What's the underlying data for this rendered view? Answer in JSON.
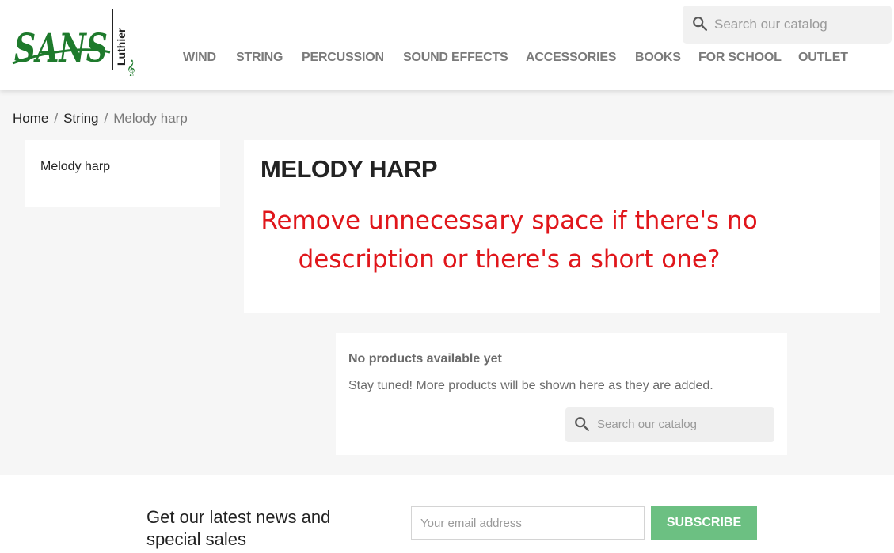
{
  "header": {
    "logo": {
      "text": "SANS",
      "subtext": "Luthier"
    },
    "search_placeholder": "Search our catalog",
    "nav": [
      "WIND",
      "STRING",
      "PERCUSSION",
      "SOUND EFFECTS",
      "ACCESSORIES",
      "BOOKS",
      "FOR SCHOOL",
      "OUTLET"
    ]
  },
  "breadcrumb": {
    "items": [
      "Home",
      "String"
    ],
    "current": "Melody harp"
  },
  "sidebar": {
    "items": [
      "Melody harp"
    ]
  },
  "category": {
    "title": "MELODY HARP",
    "annotation": "Remove unnecessary space if there's no description or there's a short one?"
  },
  "no_products": {
    "title": "No products available yet",
    "message": "Stay tuned! More products will be shown here as they are added.",
    "search_placeholder": "Search our catalog"
  },
  "newsletter": {
    "title": "Get our latest news and special sales",
    "email_placeholder": "Your email address",
    "button": "SUBSCRIBE"
  },
  "colors": {
    "logo_green": "#1e7a2c",
    "annotation_red": "#e0161b",
    "subscribe_green": "#6cc082"
  }
}
